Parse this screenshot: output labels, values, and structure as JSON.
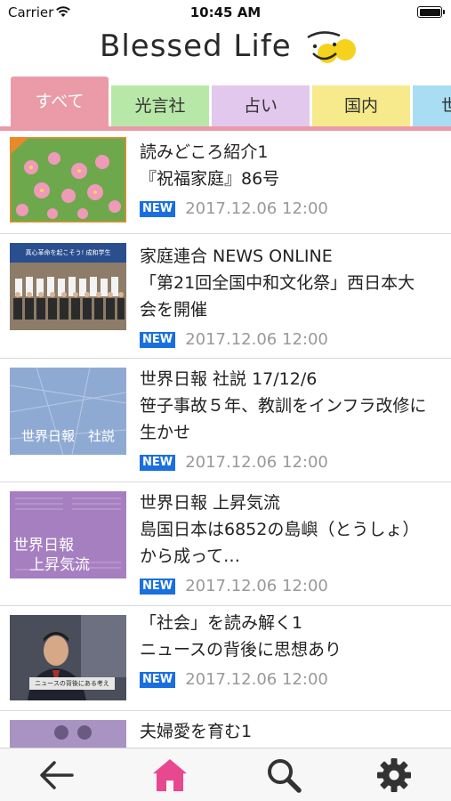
{
  "status_bar": {
    "carrier": "Carrier",
    "time": "10:45 AM",
    "battery_level": 1.0
  },
  "header": {
    "logo_text": "Blessed Life",
    "logo_accent_color": "#f5d21c"
  },
  "tabs": [
    {
      "label": "すべて",
      "color": "#eb9aa8",
      "active": true
    },
    {
      "label": "光言社",
      "color": "#b8e8a8",
      "active": false
    },
    {
      "label": "占い",
      "color": "#e3c8ee",
      "active": false
    },
    {
      "label": "国内",
      "color": "#f7ea8c",
      "active": false
    },
    {
      "label": "世",
      "color": "#a9ddf3",
      "active": false
    }
  ],
  "articles": [
    {
      "title_line1": "読みどころ紹介1",
      "title_line2": "『祝福家庭』86号",
      "title_line3": "",
      "badge": "NEW",
      "date": "2017.12.06 12:00"
    },
    {
      "title_line1": "家庭連合 NEWS ONLINE",
      "title_line2": "「第21回全国中和文化祭」西日本大",
      "title_line3": "会を開催",
      "badge": "NEW",
      "date": "2017.12.06 12:00",
      "thumb_caption": "真心革命を起こそう! 成和学生"
    },
    {
      "title_line1": "世界日報 社説 17/12/6",
      "title_line2": "笹子事故５年、教訓をインフラ改修に",
      "title_line3": "生かせ",
      "badge": "NEW",
      "date": "2017.12.06 12:00",
      "thumb_caption": "世界日報　社説"
    },
    {
      "title_line1": "世界日報 上昇気流",
      "title_line2": "島国日本は6852の島嶼（とうしょ）",
      "title_line3": "から成って…",
      "badge": "NEW",
      "date": "2017.12.06 12:00",
      "thumb_caption_1": "世界日報",
      "thumb_caption_2": "上昇気流"
    },
    {
      "title_line1": "「社会」を読み解く1",
      "title_line2": "ニュースの背後に思想あり",
      "title_line3": "",
      "badge": "NEW",
      "date": "2017.12.06 12:00",
      "thumb_caption": "ニュースの背後にある考え"
    },
    {
      "title_line1": "夫婦愛を育む1",
      "title_line2": "",
      "title_line3": "",
      "badge": "",
      "date": ""
    }
  ],
  "tabbar": {
    "back_icon": "arrow-left-icon",
    "home_icon": "home-icon",
    "search_icon": "search-icon",
    "settings_icon": "gear-icon",
    "active_color": "#e8488f"
  }
}
